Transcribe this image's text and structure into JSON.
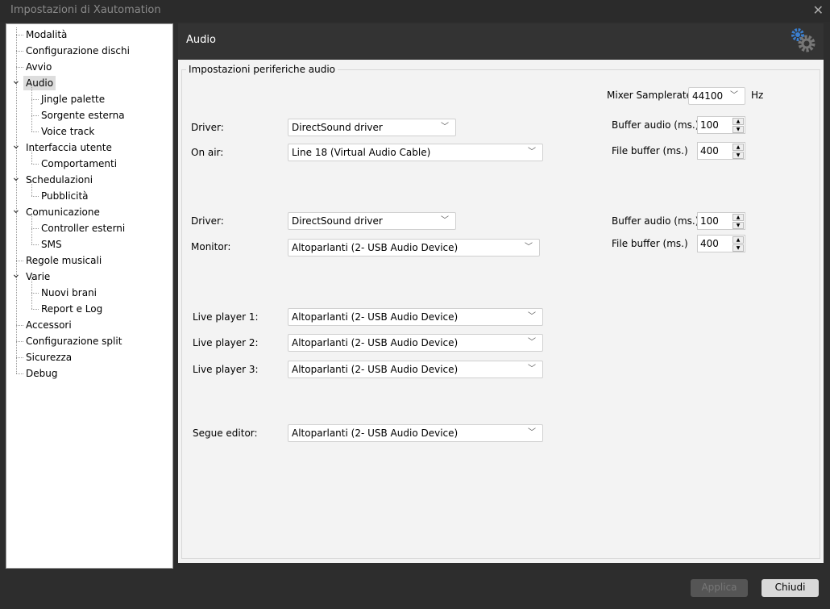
{
  "window": {
    "title": "Impostazioni di Xautomation",
    "close": "✕"
  },
  "tree": [
    {
      "label": "Modalità",
      "level": 0
    },
    {
      "label": "Configurazione dischi",
      "level": 0
    },
    {
      "label": "Avvio",
      "level": 0
    },
    {
      "label": "Audio",
      "level": 0,
      "expanded": true,
      "selected": true
    },
    {
      "label": "Jingle palette",
      "level": 1
    },
    {
      "label": "Sorgente esterna",
      "level": 1
    },
    {
      "label": "Voice track",
      "level": 1
    },
    {
      "label": "Interfaccia utente",
      "level": 0,
      "expanded": true
    },
    {
      "label": "Comportamenti",
      "level": 1
    },
    {
      "label": "Schedulazioni",
      "level": 0,
      "expanded": true
    },
    {
      "label": "Pubblicità",
      "level": 1
    },
    {
      "label": "Comunicazione",
      "level": 0,
      "expanded": true
    },
    {
      "label": "Controller esterni",
      "level": 1
    },
    {
      "label": "SMS",
      "level": 1
    },
    {
      "label": "Regole musicali",
      "level": 0
    },
    {
      "label": "Varie",
      "level": 0,
      "expanded": true
    },
    {
      "label": "Nuovi brani",
      "level": 1
    },
    {
      "label": "Report e Log",
      "level": 1
    },
    {
      "label": "Accessori",
      "level": 0
    },
    {
      "label": "Configurazione split",
      "level": 0
    },
    {
      "label": "Sicurezza",
      "level": 0
    },
    {
      "label": "Debug",
      "level": 0
    }
  ],
  "header": {
    "title": "Audio",
    "icon": "gears-icon"
  },
  "group": {
    "title": "Impostazioni periferiche audio"
  },
  "mixer": {
    "label": "Mixer Samplerate:",
    "value": "44100",
    "unit": "Hz"
  },
  "onair": {
    "driver_label": "Driver:",
    "driver": "DirectSound driver",
    "device_label": "On air:",
    "device": "Line 18 (Virtual Audio Cable)",
    "buffer_label": "Buffer audio (ms.)",
    "buffer": "100",
    "file_label": "File buffer (ms.)",
    "file": "400"
  },
  "monitor": {
    "driver_label": "Driver:",
    "driver": "DirectSound driver",
    "device_label": "Monitor:",
    "device": "Altoparlanti (2- USB Audio Device)",
    "buffer_label": "Buffer audio (ms.)",
    "buffer": "100",
    "file_label": "File buffer (ms.)",
    "file": "400"
  },
  "live": [
    {
      "label": "Live player 1:",
      "device": "Altoparlanti (2- USB Audio Device)"
    },
    {
      "label": "Live player 2:",
      "device": "Altoparlanti (2- USB Audio Device)"
    },
    {
      "label": "Live player 3:",
      "device": "Altoparlanti (2- USB Audio Device)"
    }
  ],
  "segue": {
    "label": "Segue editor:",
    "device": "Altoparlanti (2- USB Audio Device)"
  },
  "buttons": {
    "apply": "Applica",
    "close": "Chiudi"
  }
}
